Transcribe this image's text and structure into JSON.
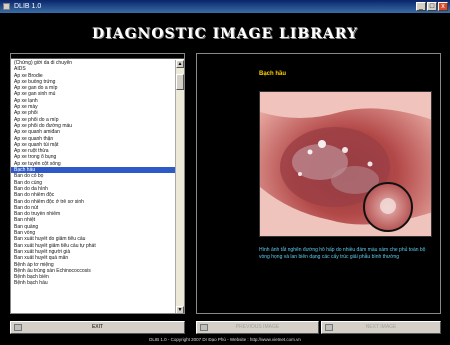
{
  "window": {
    "title": "DLIB 1.0",
    "minimize": "_",
    "maximize": "□",
    "close": "x"
  },
  "header": {
    "title": "DIAGNOSTIC IMAGE LIBRARY"
  },
  "list": {
    "items": [
      "(Chứng) giời da di chuyển",
      "AIDS",
      "Áp xe Brodie",
      "Áp xe buồng trứng",
      "Áp xe gan do a míp",
      "Áp xe gan sinh mủ",
      "Áp xe lạnh",
      "Áp xe mày",
      "Áp xe phổi",
      "Áp xe phổi do a míp",
      "Áp xe phổi do đường máu",
      "Áp xe quanh amiđan",
      "Áp xe quanh thận",
      "Áp xe quanh túi mật",
      "Áp xe ruột thừa",
      "Áp xe trong ổ bụng",
      "Áp xe tuyến cột sống",
      "Bạch hầu",
      "Ban do cỏ bọ",
      "Ban do cùng",
      "Ban do da hình",
      "Ban do nhiễm độc",
      "Ban do nhiễm độc ở trẻ sơ sinh",
      "Ban do nút",
      "Ban do truyền nhiễm",
      "Ban nhiệt",
      "Ban quầng",
      "Ban vòng",
      "Ban xuất huyết do giảm tiểu cầu",
      "Ban xuất huyết giảm tiểu cầu tự phát",
      "Ban xuất huyết người già",
      "Ban xuất huyết quá mẫn",
      "Bệnh áp tơ miệng",
      "Bệnh ấu trùng sán Echinococcosis",
      "Bệnh bạch biến",
      "Bệnh bạch hầu"
    ],
    "selected_index": 17
  },
  "viewer": {
    "diagnosis": "Bạch hầu",
    "caption": "Hình ảnh tắt nghẽn đường hô hấp do nhiều đám màu xám che phủ toàn bộ vòng họng và lan biên dạng các cấy trúc giải phẫu bình thường"
  },
  "buttons": {
    "exit": "EXIT",
    "previous": "PREVIOUS IMAGE",
    "next": "NEXT IMAGE"
  },
  "footer": {
    "text": "DLIB 1.0 - Copyright 2007 Dr Đạo Phú - Website : http://www.vietnet.com.vn"
  }
}
